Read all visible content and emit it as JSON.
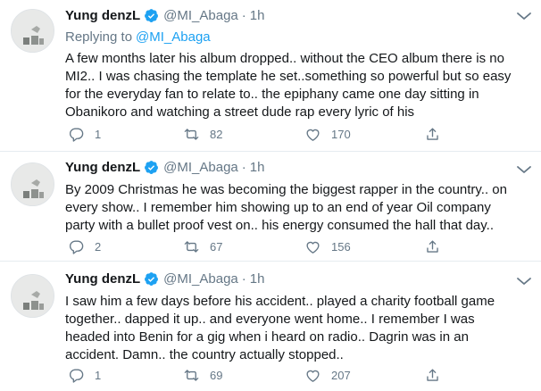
{
  "tweets": [
    {
      "name": "Yung denzL",
      "handle": "@MI_Abaga",
      "dot": "·",
      "time": "1h",
      "replying_prefix": "Replying to",
      "replying_handle": "@MI_Abaga",
      "lines": [
        "A few months later his album dropped.. without the CEO album there is no",
        "MI2.. I was chasing the template he set..something so powerful but so easy",
        "for the everyday fan to relate to.. the epiphany came one day sitting in",
        "Obanikoro and watching a street dude rap every lyric of his"
      ],
      "replies": "1",
      "retweets": "82",
      "likes": "170"
    },
    {
      "name": "Yung denzL",
      "handle": "@MI_Abaga",
      "dot": "·",
      "time": "1h",
      "lines": [
        "By 2009 Christmas he was becoming the biggest rapper in the country.. on",
        "every show.. I remember him showing up to an end of year Oil company",
        "party with a bullet proof vest on.. his energy consumed the hall that day.."
      ],
      "replies": "2",
      "retweets": "67",
      "likes": "156"
    },
    {
      "name": "Yung denzL",
      "handle": "@MI_Abaga",
      "dot": "·",
      "time": "1h",
      "lines": [
        "I saw him a few days before his accident.. played a charity football game",
        "together.. dapped it up.. and everyone went home.. I remember I was",
        "headed into Benin for a gig when i heard on radio.. Dagrin was in an",
        "accident. Damn.. the country actually stopped.."
      ],
      "replies": "1",
      "retweets": "69",
      "likes": "207"
    }
  ],
  "colors": {
    "text": "#14171a",
    "muted": "#657786",
    "link": "#1da1f2",
    "verified": "#1da1f2",
    "divider": "#e6ecf0"
  },
  "icons": [
    "verified-badge-icon",
    "chevron-down-icon",
    "reply-icon",
    "retweet-icon",
    "like-icon",
    "share-icon"
  ]
}
